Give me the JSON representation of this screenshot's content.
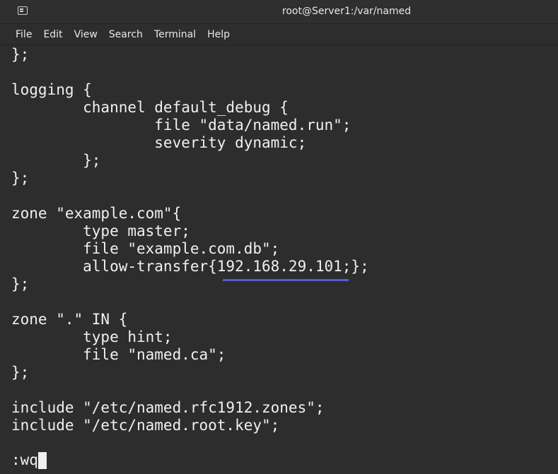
{
  "window": {
    "title": "root@Server1:/var/named",
    "icon": "terminal-icon"
  },
  "menubar": {
    "items": [
      {
        "label": "File"
      },
      {
        "label": "Edit"
      },
      {
        "label": "View"
      },
      {
        "label": "Search"
      },
      {
        "label": "Terminal"
      },
      {
        "label": "Help"
      }
    ]
  },
  "terminal": {
    "lines": [
      "};",
      "",
      "logging {",
      "        channel default_debug {",
      "                file \"data/named.run\";",
      "                severity dynamic;",
      "        };",
      "};",
      "",
      "zone \"example.com\"{",
      "        type master;",
      "        file \"example.com.db\";",
      "        allow-transfer{192.168.29.101;};",
      "};",
      "",
      "zone \".\" IN {",
      "        type hint;",
      "        file \"named.ca\";",
      "};",
      "",
      "include \"/etc/named.rfc1912.zones\";",
      "include \"/etc/named.root.key\";"
    ],
    "command": ":wq"
  },
  "colors": {
    "background": "#2d2d2d",
    "text": "#f0f0f0",
    "annotation_underline": "#5a5ad8"
  }
}
